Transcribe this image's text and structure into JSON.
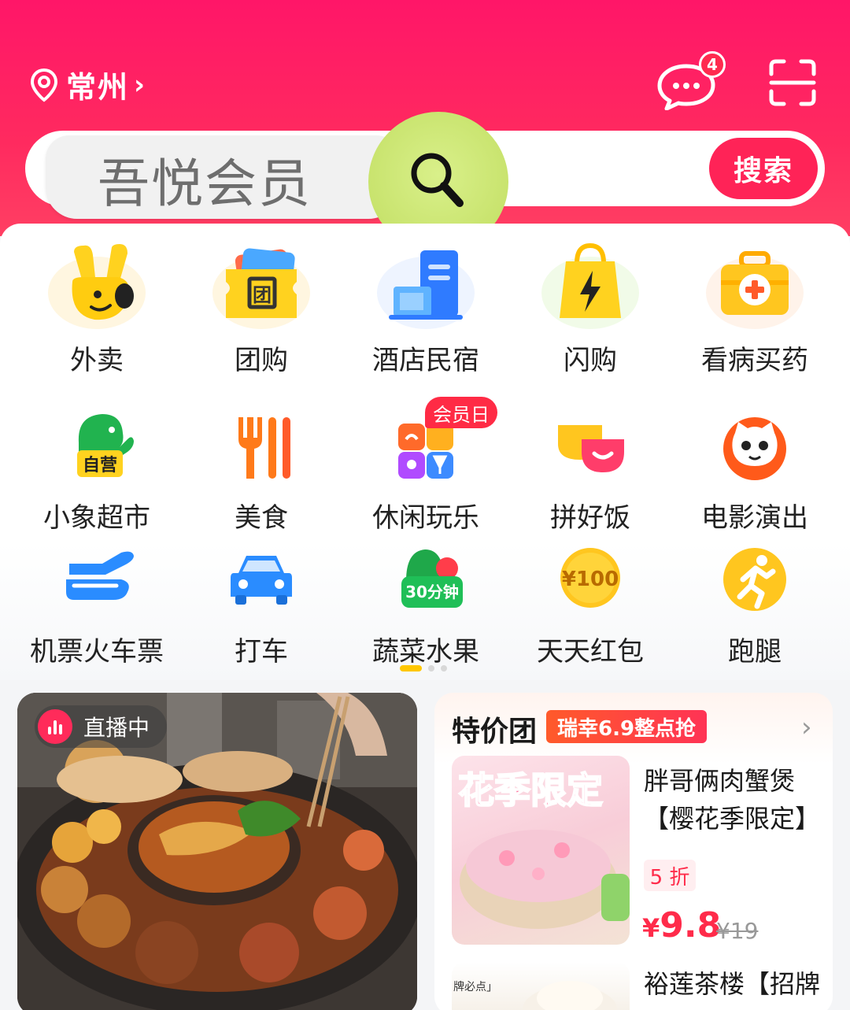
{
  "header": {
    "location": "常州",
    "message_badge": "4",
    "search_tag": "吾悦会员",
    "search_button": "搜索"
  },
  "categories": [
    {
      "label": "外卖",
      "icon": "kangaroo-hand-icon"
    },
    {
      "label": "团购",
      "icon": "group-coupon-icon"
    },
    {
      "label": "酒店民宿",
      "icon": "hotel-building-icon"
    },
    {
      "label": "闪购",
      "icon": "lightning-bag-icon"
    },
    {
      "label": "看病买药",
      "icon": "medical-kit-icon"
    },
    {
      "label": "小象超市",
      "icon": "elephant-icon",
      "tag": "自营"
    },
    {
      "label": "美食",
      "icon": "fork-icon"
    },
    {
      "label": "休闲玩乐",
      "icon": "leisure-grid-icon",
      "badge": "会员日"
    },
    {
      "label": "拼好饭",
      "icon": "bowl-icon"
    },
    {
      "label": "电影演出",
      "icon": "cat-face-icon"
    },
    {
      "label": "机票火车票",
      "icon": "plane-icon"
    },
    {
      "label": "打车",
      "icon": "car-icon"
    },
    {
      "label": "蔬菜水果",
      "icon": "vegetable-icon",
      "tag": "30分钟"
    },
    {
      "label": "天天红包",
      "icon": "coin-icon",
      "tag": "¥100"
    },
    {
      "label": "跑腿",
      "icon": "runner-icon"
    }
  ],
  "live": {
    "badge": "直播中"
  },
  "deal": {
    "title": "特价团",
    "tag": "瑞幸6.9整点抢",
    "item1": {
      "name": "胖哥俩肉蟹煲【樱花季限定】",
      "image_text": "花季限定",
      "discount": "5 折",
      "currency": "¥",
      "price": "9.8",
      "original_price": "¥19"
    },
    "item2": {
      "name": "裕莲茶楼【招牌",
      "image_text": "牌必点」"
    }
  },
  "colors": {
    "brand": "#ff1668",
    "accent_yellow": "#ffc700"
  }
}
